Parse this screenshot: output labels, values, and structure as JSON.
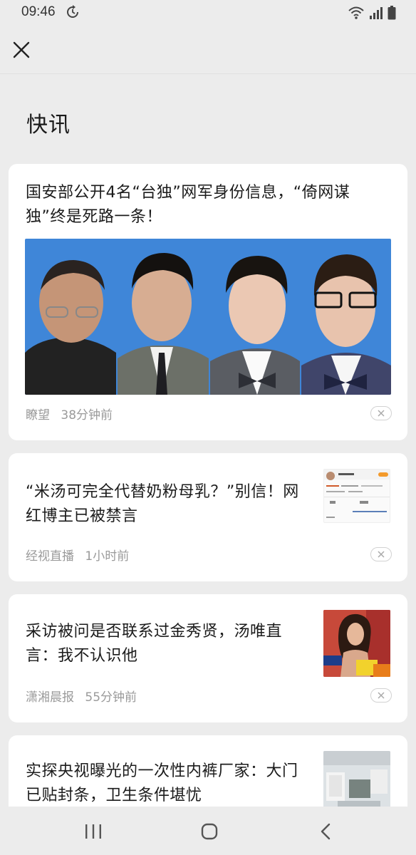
{
  "status_bar": {
    "time": "09:46",
    "icons": [
      "sync-icon",
      "wifi-icon",
      "signal-icon",
      "battery-icon"
    ]
  },
  "header": {
    "close_icon": "close-icon"
  },
  "page": {
    "title": "快讯"
  },
  "articles": [
    {
      "title": "国安部公开4名“台独”网军身份信息，“倚网谋独”终是死路一条！",
      "source": "瞭望",
      "time": "38分钟前",
      "image": "four-men-portraits"
    },
    {
      "title": "“米汤可完全代替奶粉母乳？”别信！网红博主已被禁言",
      "source": "经视直播",
      "time": "1小时前",
      "image": "social-profile-screenshot"
    },
    {
      "title": "采访被问是否联系过金秀贤，汤唯直言：我不认识他",
      "source": "潇湘晨报",
      "time": "55分钟前",
      "image": "actress-photo"
    },
    {
      "title": "实探央视曝光的一次性内裤厂家：大门已贴封条，卫生条件堪忧",
      "source": "",
      "time": "",
      "image": "factory-photo"
    }
  ],
  "colors": {
    "background": "#ececec",
    "card": "#ffffff",
    "meta_text": "#9a9a9a",
    "photo_background": "#3f86d8"
  },
  "nav": {
    "recent_icon": "recent-apps-icon",
    "home_icon": "home-icon",
    "back_icon": "back-icon"
  }
}
